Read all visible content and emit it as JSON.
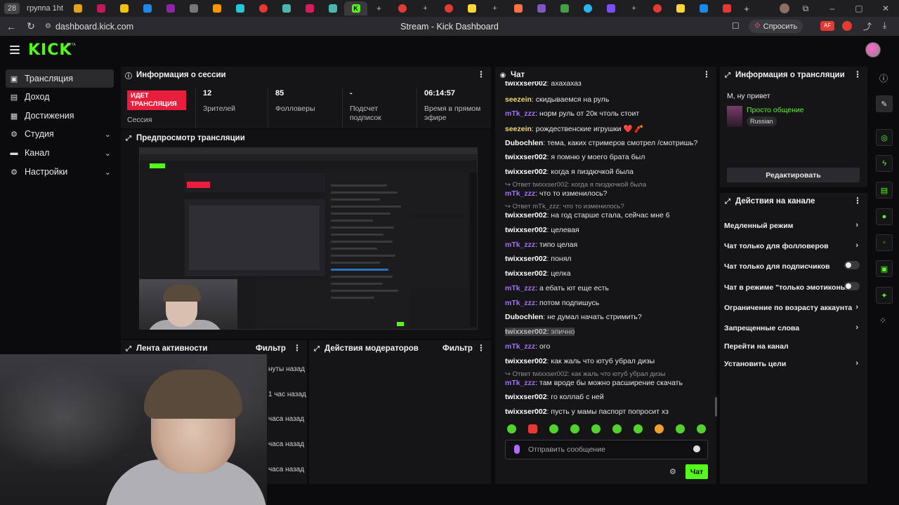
{
  "browser": {
    "tab_count": "28",
    "tab_group_label": "группа 1ht",
    "active_tab_letter": "K",
    "url": "dashboard.kick.com",
    "page_title": "Stream - Kick Dashboard",
    "ask_button": "Спросить",
    "ext_badge": "AF",
    "ext_badge_count": "4"
  },
  "header": {
    "logo": "KICK",
    "logo_badge": "BETA"
  },
  "sidebar": {
    "items": [
      {
        "label": "Трансляция",
        "icon": "broadcast-icon"
      },
      {
        "label": "Доход",
        "icon": "money-icon"
      },
      {
        "label": "Достижения",
        "icon": "achievements-icon"
      },
      {
        "label": "Студия",
        "icon": "studio-gear-icon"
      },
      {
        "label": "Канал",
        "icon": "channel-icon"
      },
      {
        "label": "Настройки",
        "icon": "settings-gear-icon"
      }
    ]
  },
  "session": {
    "title": "Информация о сессии",
    "live_badge": "ИДЕТ ТРАНСЛЯЦИЯ",
    "session_label": "Сессия",
    "stats": [
      {
        "value": "12",
        "label": "Зрителей"
      },
      {
        "value": "85",
        "label": "Фолловеры"
      },
      {
        "value": "-",
        "label": "Подсчет подписок"
      },
      {
        "value": "06:14:57",
        "label": "Время в прямом эфире"
      }
    ]
  },
  "preview": {
    "title": "Предпросмотр трансляции"
  },
  "activity": {
    "title": "Лента активности",
    "filter": "Фильтр",
    "times": [
      "нуты назад",
      "1 час назад",
      "часа назад",
      "часа назад",
      "часа назад"
    ]
  },
  "mod_actions": {
    "title": "Действия модераторов",
    "filter": "Фильтр"
  },
  "chat": {
    "title": "Чат",
    "messages": [
      {
        "user": "twixxser002",
        "text": "ахахахаз",
        "color": "white"
      },
      {
        "user": "seezein",
        "text": "скидываемся на руль",
        "color": "yellow"
      },
      {
        "user": "mTk_zzz",
        "text": "норм руль от 20к чтоль стоит",
        "color": "purple"
      },
      {
        "user": "seezein",
        "text": "рождественские игрушки ❤️ 🧨",
        "color": "yellow"
      },
      {
        "user": "Dubochlen",
        "text": "тема, каких стримеров смотрел /смотришь?",
        "color": "white"
      },
      {
        "user": "twixxser002",
        "text": "я помню у моего брата был",
        "color": "white"
      },
      {
        "user": "twixxser002",
        "text": "когда я пиздючкой была",
        "color": "white"
      },
      {
        "reply": "Ответ twixxser002: когда я пиздючкой была"
      },
      {
        "user": "mTk_zzz",
        "text": "что то изменилось?",
        "color": "purple"
      },
      {
        "reply": "Ответ mTk_zzz: что то изменилось?"
      },
      {
        "user": "twixxser002",
        "text": "на год старше стала, сейчас мне 6",
        "color": "white"
      },
      {
        "user": "twixxser002",
        "text": "целевая",
        "color": "white"
      },
      {
        "user": "mTk_zzz",
        "text": "типо целая",
        "color": "purple"
      },
      {
        "user": "twixxser002",
        "text": "понял",
        "color": "white"
      },
      {
        "user": "twixxser002",
        "text": "целка",
        "color": "white"
      },
      {
        "user": "mTk_zzz",
        "text": "а ебать ют еще есть",
        "color": "purple"
      },
      {
        "user": "mTk_zzz",
        "text": "потом подпишусь",
        "color": "purple"
      },
      {
        "user": "Dubochlen",
        "text": "не думал начать стримить?",
        "color": "white"
      },
      {
        "user": "twixxser002",
        "text": "эпично",
        "color": "white"
      },
      {
        "user": "mTk_zzz",
        "text": "ого",
        "color": "purple"
      },
      {
        "user": "twixxser002",
        "text": "как жаль что ютуб убрал дизы",
        "color": "white"
      },
      {
        "reply": "Ответ twixxser002: как жаль что ютуб убрал дизы"
      },
      {
        "user": "mTk_zzz",
        "text": "там вроде бы можно расширение скачать",
        "color": "purple"
      },
      {
        "user": "twixxser002",
        "text": "го коллаб с ней",
        "color": "white"
      },
      {
        "user": "twixxser002",
        "text": "пусть у мамы паспорт попросит хз",
        "color": "white"
      }
    ],
    "input_placeholder": "Отправить сообщение",
    "send_label": "Чат"
  },
  "stream_info": {
    "title": "Информация о трансляции",
    "stream_title": "М, ну привет",
    "category": "Просто общение",
    "language": "Russian",
    "edit_label": "Редактировать"
  },
  "channel_actions": {
    "title": "Действия на канале",
    "items": [
      {
        "label": "Медленный режим",
        "control": "chevron"
      },
      {
        "label": "Чат только для фолловеров",
        "control": "chevron"
      },
      {
        "label": "Чат только для подписчиков",
        "control": "toggle"
      },
      {
        "label": "Чат в режиме \"только эмотиконы\"",
        "control": "toggle"
      },
      {
        "label": "Ограничение по возрасту аккаунта",
        "control": "chevron"
      },
      {
        "label": "Запрещенные слова",
        "control": "chevron"
      },
      {
        "label": "Перейти на канал",
        "control": "none"
      },
      {
        "label": "Установить цели",
        "control": "chevron"
      }
    ]
  },
  "colors": {
    "accent": "#53fc18",
    "live": "#e91e3c",
    "panel": "#151517",
    "bg": "#0b0b0d",
    "user_purple": "#a371f7",
    "user_yellow": "#f5d76e"
  }
}
